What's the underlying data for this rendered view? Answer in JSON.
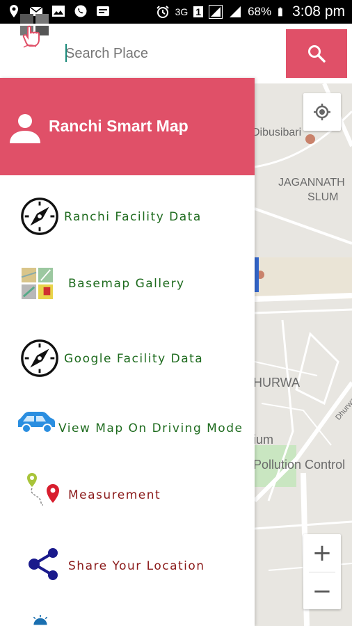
{
  "status_bar": {
    "network": "3G",
    "sim": "1",
    "battery": "68%",
    "time": "3:08 pm"
  },
  "search": {
    "placeholder": "Search Place"
  },
  "drawer": {
    "title": "Ranchi Smart Map",
    "items": [
      {
        "label": "Ranchi Facility Data",
        "icon": "compass-icon"
      },
      {
        "label": "Basemap Gallery",
        "icon": "basemap-gallery-icon"
      },
      {
        "label": "Google Facility Data",
        "icon": "compass-icon"
      },
      {
        "label": "View Map On Driving Mode",
        "icon": "car-icon"
      },
      {
        "label": "Measurement",
        "icon": "map-pins-icon"
      },
      {
        "label": "Share Your Location",
        "icon": "share-icon"
      }
    ]
  },
  "map": {
    "labels": [
      "Dibusibari",
      "JAGANNATH",
      "SLUM",
      "HURWA",
      "Dhurwa",
      "ium",
      "Pollution Control"
    ]
  },
  "colors": {
    "accent": "#e05068",
    "menu_text_green": "#1e6b1e",
    "menu_text_red": "#8b1a1a"
  }
}
